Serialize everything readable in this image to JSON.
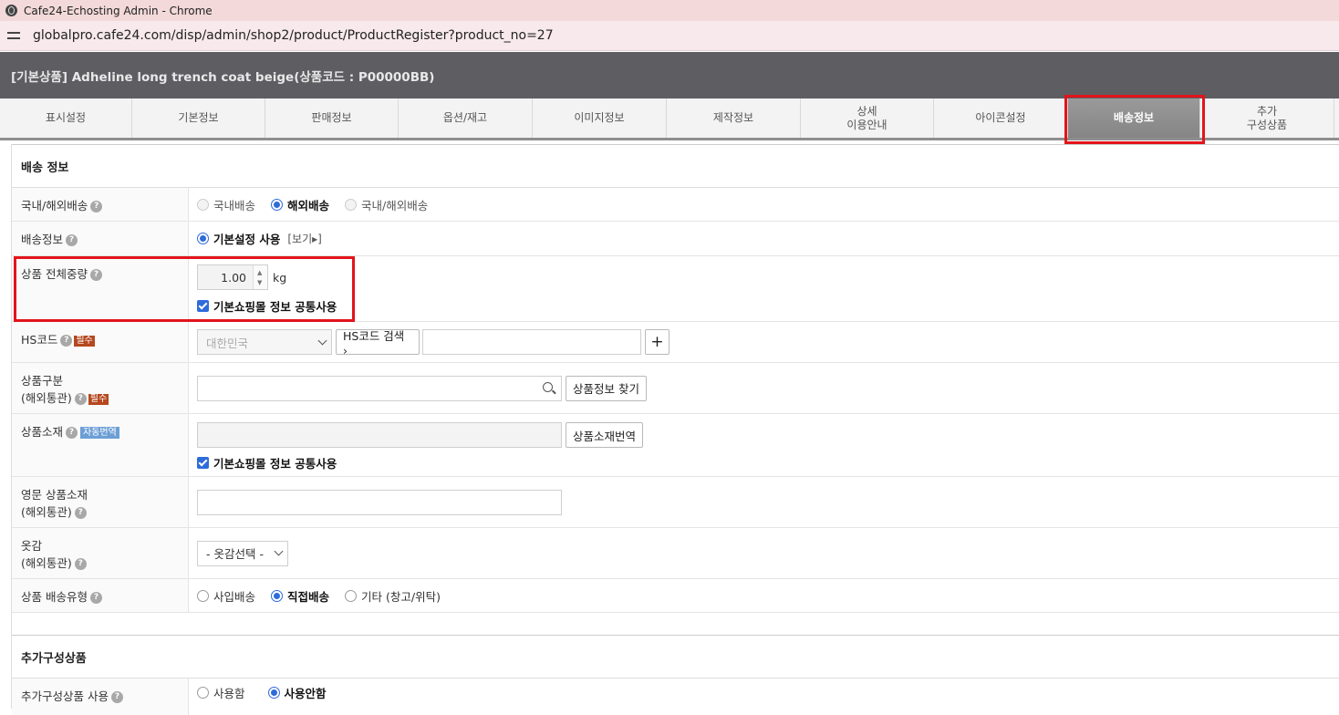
{
  "window": {
    "title": "Cafe24-Echosting Admin - Chrome",
    "url": "globalpro.cafe24.com/disp/admin/shop2/product/ProductRegister?product_no=27"
  },
  "header": {
    "title": "[기본상품] Adheline long trench coat beige(상품코드 : P00000BB)"
  },
  "tabs": [
    {
      "label": "표시설정"
    },
    {
      "label": "기본정보"
    },
    {
      "label": "판매정보"
    },
    {
      "label": "옵션/재고"
    },
    {
      "label": "이미지정보"
    },
    {
      "label": "제작정보"
    },
    {
      "label": "상세\n이용안내"
    },
    {
      "label": "아이콘설정"
    },
    {
      "label": "배송정보",
      "active": true
    },
    {
      "label": "추가\n구성상품"
    }
  ],
  "shipping": {
    "title": "배송 정보",
    "domestic_overseas": {
      "label": "국내/해외배송",
      "options": [
        "국내배송",
        "해외배송",
        "국내/해외배송"
      ],
      "selected": "해외배송"
    },
    "shipping_info": {
      "label": "배송정보",
      "option": "기본설정 사용",
      "view_link": "[보기▸]"
    },
    "weight": {
      "label": "상품 전체중량",
      "value": "1.00",
      "unit": "kg",
      "checkbox_label": "기본쇼핑몰 정보 공통사용",
      "checked": true
    },
    "hs_code": {
      "label": "HS코드",
      "required": "필수",
      "country": "대한민국",
      "search_button": "HS코드 검색 ›",
      "code_value": "",
      "add_button": "+"
    },
    "product_category": {
      "label_line1": "상품구분",
      "label_line2": "(해외통관)",
      "required": "필수",
      "search_value": "",
      "find_button": "상품정보 찾기"
    },
    "material": {
      "label": "상품소재",
      "auto_badge": "자동번역",
      "value": "",
      "translate_button": "상품소재번역",
      "checkbox_label": "기본쇼핑몰 정보 공통사용",
      "checked": true
    },
    "english_material": {
      "label_line1": "영문 상품소재",
      "label_line2": "(해외통관)",
      "value": ""
    },
    "fabric": {
      "label_line1": "옷감",
      "label_line2": "(해외통관)",
      "select_value": "- 옷감선택 -"
    },
    "delivery_type": {
      "label": "상품 배송유형",
      "options": [
        "사입배송",
        "직접배송",
        "기타 (창고/위탁)"
      ],
      "selected": "직접배송"
    }
  },
  "additional": {
    "title": "추가구성상품",
    "use": {
      "label": "추가구성상품 사용",
      "options": [
        "사용함",
        "사용안함"
      ],
      "selected": "사용안함"
    }
  },
  "colors": {
    "header_bg": "#5d5d62",
    "active_tab": "#8f8f8f",
    "highlight": "#e3141b",
    "radio_blue": "#2f6bd9",
    "required_badge": "#b5481f",
    "auto_badge": "#6d9fd6"
  }
}
